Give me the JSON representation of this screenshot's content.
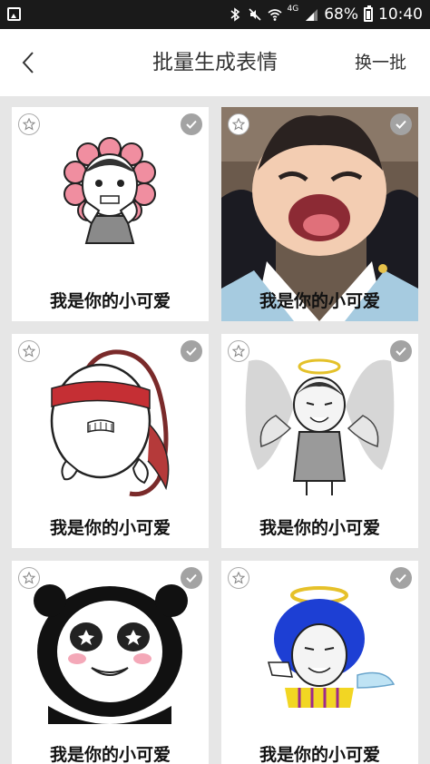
{
  "status_bar": {
    "icons": [
      "gallery-icon",
      "bluetooth-icon",
      "mute-icon",
      "wifi-icon",
      "signal-icon",
      "battery-icon"
    ],
    "network": "4G",
    "battery": "68%",
    "time": "10:40"
  },
  "header": {
    "back_icon": "chevron-left-icon",
    "title": "批量生成表情",
    "refresh": "换一批"
  },
  "stickers": [
    {
      "caption": "我是你的小可爱",
      "image": "flower-kid-sticker"
    },
    {
      "caption": "我是你的小可爱",
      "image": "laughing-baby-photo"
    },
    {
      "caption": "我是你的小可爱",
      "image": "blindfold-egg-sticker"
    },
    {
      "caption": "我是你的小可爱",
      "image": "angel-meme-sticker"
    },
    {
      "caption": "我是你的小可爱",
      "image": "panda-meme-sticker"
    },
    {
      "caption": "我是你的小可爱",
      "image": "blue-hair-angel-sticker"
    }
  ],
  "colors": {
    "background": "#e6e6e6",
    "check_badge": "#a3a3a3",
    "status_bar": "#1a1a1a"
  }
}
